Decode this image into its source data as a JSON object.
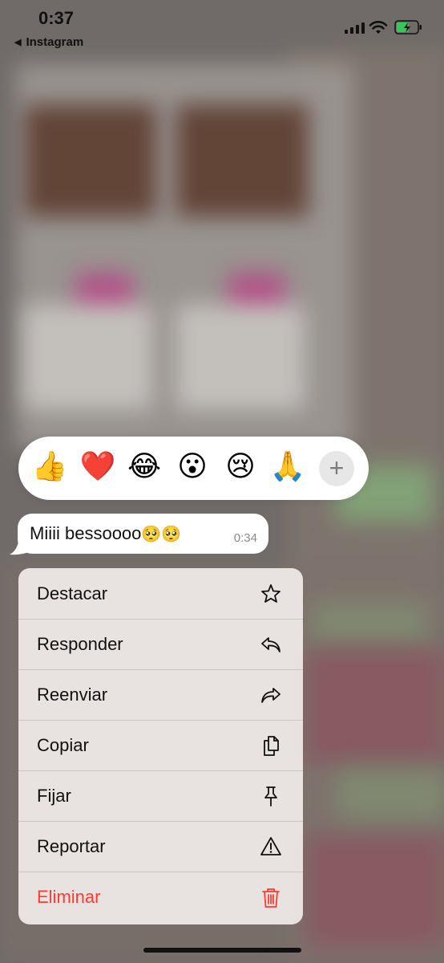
{
  "status_bar": {
    "time": "0:37",
    "back_app": "Instagram"
  },
  "reactions": {
    "emojis": [
      "👍",
      "❤️",
      "😂",
      "😮",
      "😢",
      "🙏"
    ],
    "more_label": "+"
  },
  "message": {
    "text": "Miiii bessoooo",
    "emojis": "🥺🥺",
    "time": "0:34"
  },
  "menu": {
    "items": [
      {
        "label": "Destacar",
        "icon": "star-icon"
      },
      {
        "label": "Responder",
        "icon": "reply-icon"
      },
      {
        "label": "Reenviar",
        "icon": "forward-icon"
      },
      {
        "label": "Copiar",
        "icon": "copy-icon"
      },
      {
        "label": "Fijar",
        "icon": "pin-icon"
      },
      {
        "label": "Reportar",
        "icon": "warning-icon"
      },
      {
        "label": "Eliminar",
        "icon": "trash-icon"
      }
    ]
  },
  "colors": {
    "danger": "#ff3b30",
    "bubble": "#ffffff"
  }
}
